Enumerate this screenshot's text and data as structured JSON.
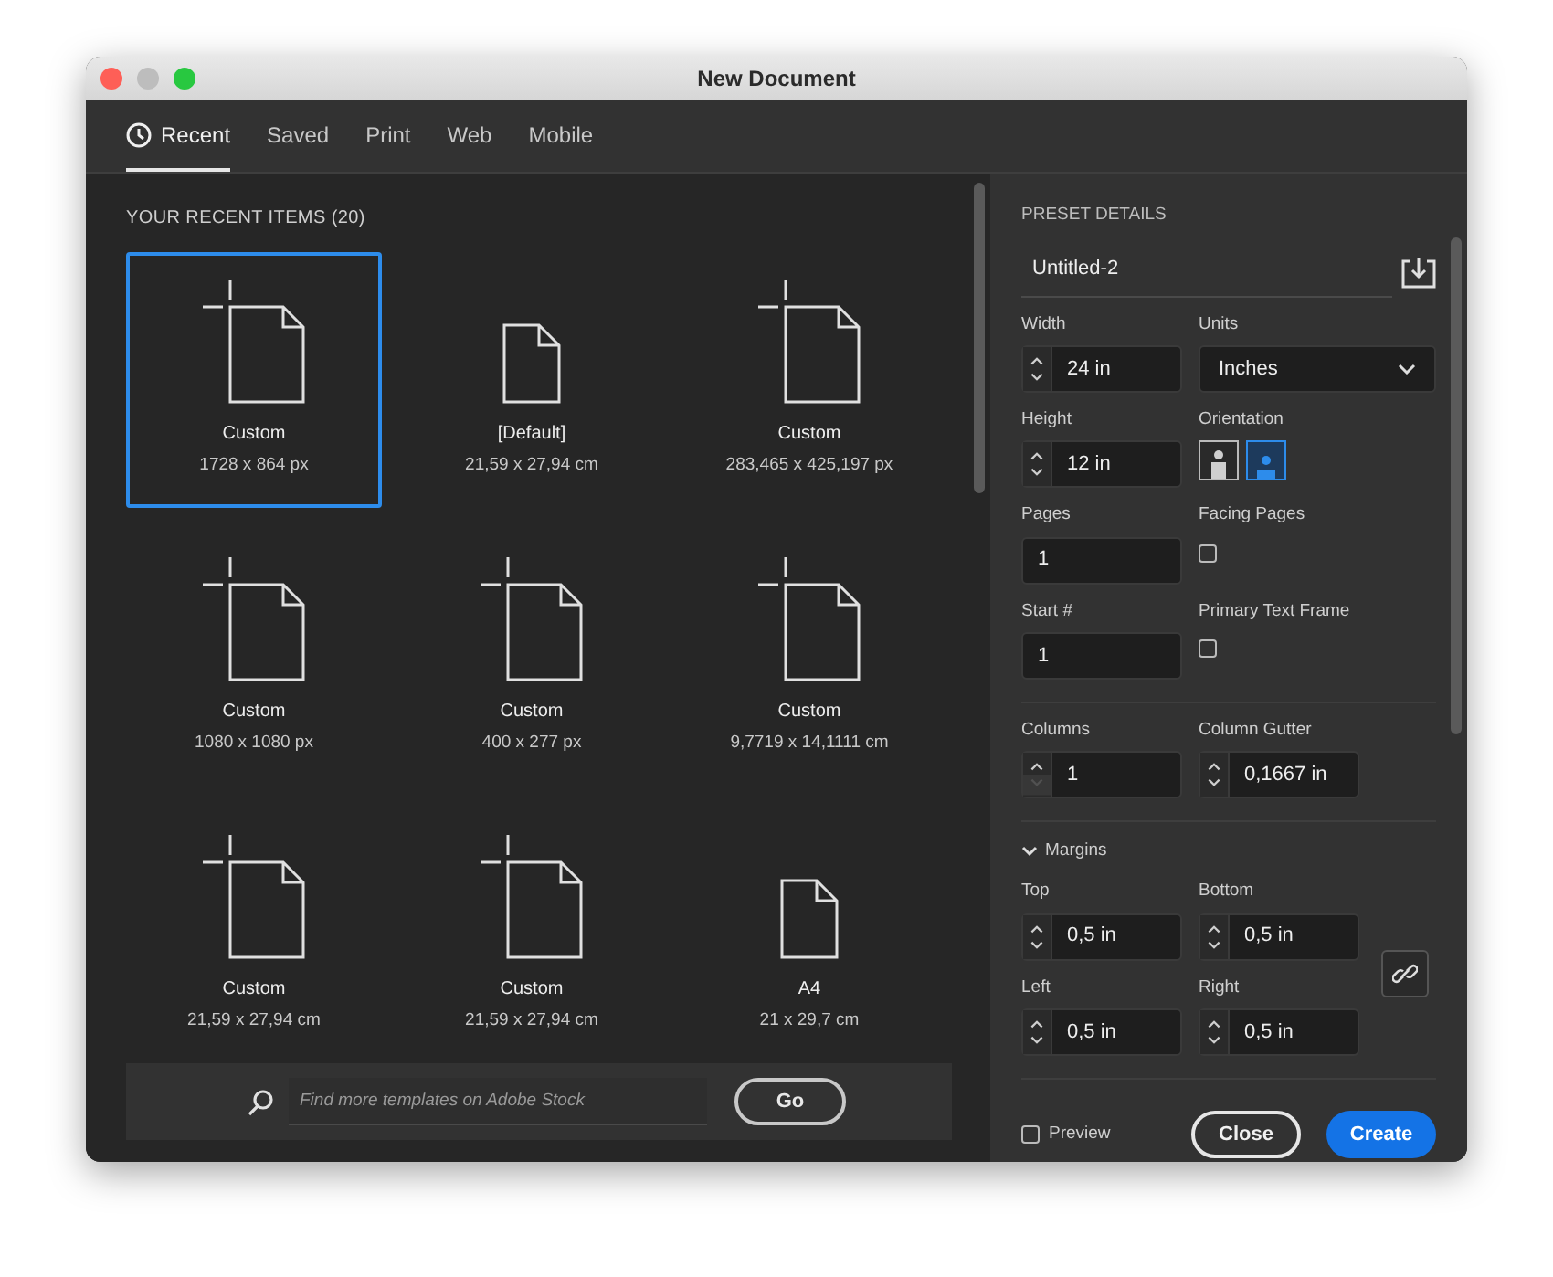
{
  "window": {
    "title": "New Document"
  },
  "tabs": [
    {
      "label": "Recent",
      "kind": "with_icon",
      "selected": true
    },
    {
      "label": "Saved",
      "kind": "plain",
      "selected": false
    },
    {
      "label": "Print",
      "kind": "plain",
      "selected": false
    },
    {
      "label": "Web",
      "kind": "plain",
      "selected": false
    },
    {
      "label": "Mobile",
      "kind": "plain",
      "selected": false
    }
  ],
  "recent": {
    "heading": "YOUR RECENT ITEMS",
    "count": "(20)",
    "items": [
      {
        "name": "Custom",
        "size": "1728 x 864 px",
        "kind": "custom",
        "selected": true
      },
      {
        "name": "[Default]",
        "size": "21,59 x 27,94 cm",
        "kind": "plain",
        "selected": false
      },
      {
        "name": "Custom",
        "size": "283,465 x 425,197 px",
        "kind": "custom",
        "selected": false
      },
      {
        "name": "Custom",
        "size": "1080 x 1080 px",
        "kind": "custom",
        "selected": false
      },
      {
        "name": "Custom",
        "size": "400 x 277 px",
        "kind": "custom",
        "selected": false
      },
      {
        "name": "Custom",
        "size": "9,7719 x 14,1111 cm",
        "kind": "custom",
        "selected": false
      },
      {
        "name": "Custom",
        "size": "21,59 x 27,94 cm",
        "kind": "custom",
        "selected": false
      },
      {
        "name": "Custom",
        "size": "21,59 x 27,94 cm",
        "kind": "custom",
        "selected": false
      },
      {
        "name": "A4",
        "size": "21 x 29,7 cm",
        "kind": "plain",
        "selected": false
      }
    ]
  },
  "search": {
    "placeholder": "Find more templates on Adobe Stock",
    "button": "Go"
  },
  "preset": {
    "heading": "PRESET DETAILS",
    "name": "Untitled-2",
    "width": {
      "label": "Width",
      "value": "24 in",
      "stepper": true,
      "decrement_disabled": false
    },
    "units": {
      "label": "Units",
      "value": "Inches"
    },
    "height": {
      "label": "Height",
      "value": "12 in",
      "stepper": true,
      "decrement_disabled": false
    },
    "orientation": {
      "label": "Orientation",
      "options": [
        {
          "kind": "portrait",
          "selected": false
        },
        {
          "kind": "landscape",
          "selected": true
        }
      ]
    },
    "pages": {
      "label": "Pages",
      "value": "1"
    },
    "facing_pages": {
      "label": "Facing Pages",
      "checked": false
    },
    "start": {
      "label": "Start #",
      "value": "1"
    },
    "primary_text_frame": {
      "label": "Primary Text Frame",
      "checked": false
    },
    "columns": {
      "label": "Columns",
      "value": "1",
      "stepper": true,
      "decrement_disabled": true
    },
    "column_gutter": {
      "label": "Column Gutter",
      "value": "0,1667 in",
      "stepper": true,
      "decrement_disabled": false
    },
    "margins": {
      "label": "Margins",
      "expanded": true,
      "top": {
        "label": "Top",
        "value": "0,5 in",
        "stepper": true,
        "decrement_disabled": false
      },
      "bottom": {
        "label": "Bottom",
        "value": "0,5 in",
        "stepper": true,
        "decrement_disabled": false
      },
      "left": {
        "label": "Left",
        "value": "0,5 in",
        "stepper": true,
        "decrement_disabled": false
      },
      "right": {
        "label": "Right",
        "value": "0,5 in",
        "stepper": true,
        "decrement_disabled": false
      }
    }
  },
  "footer": {
    "preview": {
      "label": "Preview",
      "checked": false
    },
    "buttons": [
      {
        "label": "Close",
        "kind": "secondary"
      },
      {
        "label": "Create",
        "kind": "primary"
      }
    ]
  }
}
